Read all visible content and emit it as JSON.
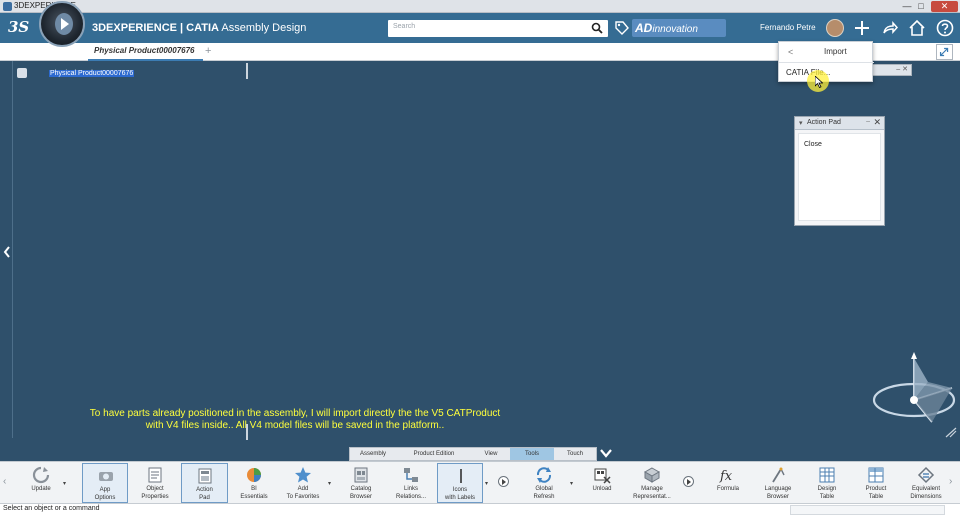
{
  "window": {
    "title": "3DEXPERIENCE",
    "buttons": {
      "minimize": "—",
      "maximize": "□",
      "close": "✕"
    }
  },
  "header": {
    "logo": "3S",
    "app_brand": "3DEXPERIENCE | CATIA",
    "app_name": "Assembly Design",
    "search_placeholder": "Search",
    "brand_ad": "AD",
    "brand_rest": "innovation",
    "user_name": "Fernando Petre"
  },
  "tabs": {
    "active": "Physical Product00007676",
    "add": "+"
  },
  "tree": {
    "root_label": "Physical Product00007676"
  },
  "import_menu": {
    "back": "<",
    "title": "Import",
    "item": "CATIA File..."
  },
  "mini_panel": {
    "text": "– ✕"
  },
  "action_pad": {
    "arrow": "▾",
    "title": "Action Pad",
    "dash": "–",
    "close_x": "✕",
    "item": "Close"
  },
  "subtitles": {
    "line1": "To have parts already positioned in the assembly, I will import directly the the V5 CATProduct",
    "line2": "with V4 files inside.. All V4 model files will be saved in the platform.."
  },
  "section_tabs": [
    "Assembly",
    "Product Edition",
    "View",
    "Tools",
    "Touch"
  ],
  "section_active": "Tools",
  "action_bar": {
    "update": "Update",
    "app_options": [
      "App",
      "Options"
    ],
    "object_properties": [
      "Object",
      "Properties"
    ],
    "action_pad": [
      "Action",
      "Pad"
    ],
    "bi_essentials": [
      "BI",
      "Essentials"
    ],
    "add_favorites": [
      "Add",
      "To Favorites"
    ],
    "catalog_browser": [
      "Catalog",
      "Browser"
    ],
    "links_relations": [
      "Links",
      "Relations..."
    ],
    "icons_labels": [
      "Icons",
      "with Labels"
    ],
    "global_refresh": [
      "Global",
      "Refresh"
    ],
    "unload": "Unload",
    "manage_representations": [
      "Manage",
      "Representat..."
    ],
    "formula": "Formula",
    "language_browser": [
      "Language",
      "Browser"
    ],
    "design_table": [
      "Design",
      "Table"
    ],
    "product_table": [
      "Product",
      "Table"
    ],
    "equivalent_dimensions": [
      "Equivalent",
      "Dimensions"
    ]
  },
  "status_bar": {
    "text": "Select an object or a command"
  },
  "colors": {
    "viewport": "#2f506b",
    "appbar": "#356c93",
    "subtitle": "#ffff3c",
    "selection": "#2d6ad0"
  }
}
